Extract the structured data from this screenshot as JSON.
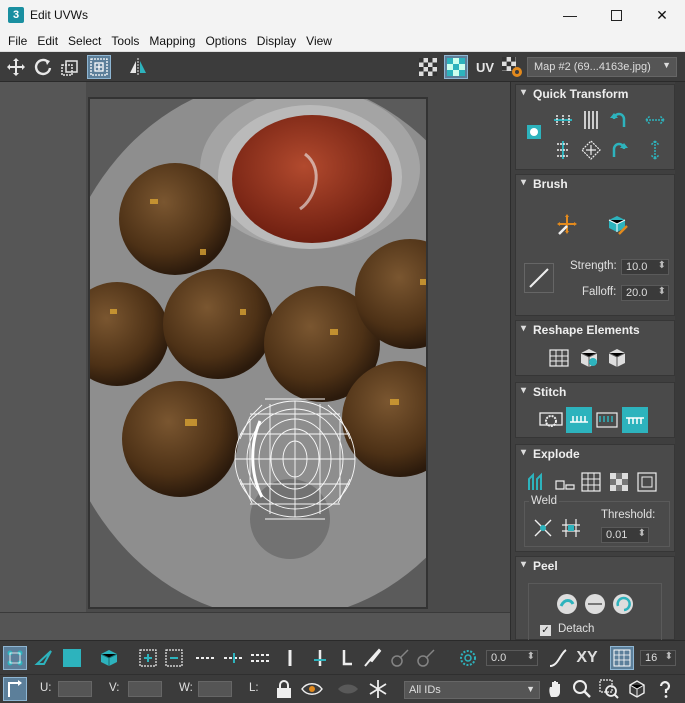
{
  "window": {
    "title": "Edit UVWs",
    "app_icon": "3",
    "minimize_icon": "minimize-icon",
    "maximize_icon": "maximize-icon",
    "close_icon": "close-icon"
  },
  "menu": [
    "File",
    "Edit",
    "Select",
    "Tools",
    "Mapping",
    "Options",
    "Display",
    "View"
  ],
  "toolbar": {
    "uv_label": "UV",
    "map_select": "Map #2 (69...4163e.jpg)"
  },
  "panel": {
    "quick_transform": {
      "title": "Quick Transform"
    },
    "brush": {
      "title": "Brush",
      "strength_label": "Strength:",
      "strength_value": "10.0",
      "falloff_label": "Falloff:",
      "falloff_value": "20.0"
    },
    "reshape": {
      "title": "Reshape Elements"
    },
    "stitch": {
      "title": "Stitch"
    },
    "explode": {
      "title": "Explode",
      "weld_label": "Weld",
      "threshold_label": "Threshold:",
      "threshold_value": "0.01"
    },
    "peel": {
      "title": "Peel",
      "detach_label": "Detach",
      "detach_checked": true
    }
  },
  "bottom": {
    "angle_value": "0.0",
    "xy_label": "XY",
    "snap_value": "16",
    "u_label": "U:",
    "v_label": "V:",
    "w_label": "W:",
    "l_label": "L:",
    "ids_select": "All IDs"
  },
  "colors": {
    "accent": "#2db3bd",
    "panel": "#4a4a4a",
    "viewport": "#4a4a4a"
  }
}
